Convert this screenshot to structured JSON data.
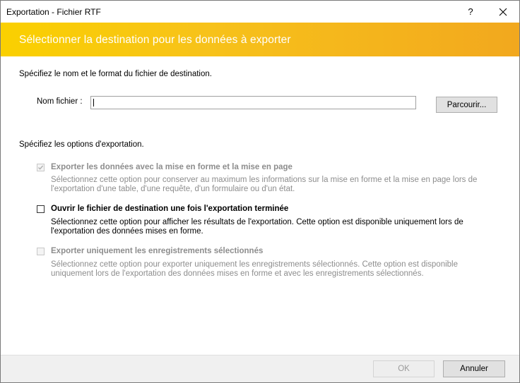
{
  "window": {
    "title": "Exportation - Fichier RTF",
    "help_label": "?",
    "close_label": "✕"
  },
  "banner": {
    "title": "Sélectionner la destination pour les données à exporter"
  },
  "destination": {
    "instruction": "Spécifiez le nom et le format du fichier de destination.",
    "filename_label": "Nom fichier :",
    "filename_value": "",
    "browse_label": "Parcourir..."
  },
  "options": {
    "instruction": "Spécifiez les options d'exportation.",
    "items": [
      {
        "label": "Exporter les données avec la mise en forme et la mise en page",
        "description_line1": "Sélectionnez cette option pour conserver au maximum les informations sur la mise en forme et la mise en page lors de",
        "description_line2": "l'exportation d'une table, d'une requête, d'un formulaire ou d'un état.",
        "checked": true,
        "enabled": false
      },
      {
        "label": "Ouvrir le fichier de destination une fois l'exportation terminée",
        "description_line1": "Sélectionnez cette option pour afficher les résultats de l'exportation. Cette option est disponible uniquement lors de",
        "description_line2": "l'exportation des données mises en forme.",
        "checked": false,
        "enabled": true
      },
      {
        "label": "Exporter uniquement les enregistrements sélectionnés",
        "description_line1": "Sélectionnez cette option pour exporter uniquement les enregistrements sélectionnés. Cette option est disponible",
        "description_line2": "uniquement lors de l'exportation des données mises en forme et avec les enregistrements sélectionnés.",
        "checked": false,
        "enabled": false
      }
    ]
  },
  "footer": {
    "ok_label": "OK",
    "cancel_label": "Annuler"
  },
  "colors": {
    "banner_start": "#fad000",
    "banner_end": "#f2a81e",
    "disabled_text": "#8d8d8d"
  }
}
